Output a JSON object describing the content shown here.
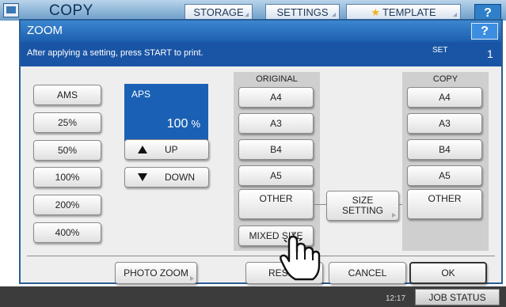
{
  "app": {
    "title": "COPY",
    "tabs": [
      "STORAGE",
      "SETTINGS",
      "TEMPLATE"
    ],
    "help": "?"
  },
  "dialog": {
    "title": "ZOOM",
    "help": "?",
    "message": "After applying a setting, press START to print.",
    "set_label": "SET",
    "set_count": "1"
  },
  "zoom_presets": [
    "AMS",
    "25%",
    "50%",
    "100%",
    "200%",
    "400%"
  ],
  "aps": {
    "label": "APS",
    "value": "100",
    "unit": "%"
  },
  "adjust": {
    "up": "UP",
    "down": "DOWN"
  },
  "original": {
    "title": "ORIGINAL",
    "sizes": [
      "A4",
      "A3",
      "B4",
      "A5",
      "OTHER",
      "MIXED SIZE"
    ]
  },
  "size_setting": "SIZE\nSETTING",
  "copy": {
    "title": "COPY",
    "sizes": [
      "A4",
      "A3",
      "B4",
      "A5",
      "OTHER"
    ]
  },
  "footer": {
    "photo_zoom": "PHOTO ZOOM",
    "reset": "RESET",
    "cancel": "CANCEL",
    "ok": "OK"
  },
  "status": {
    "time": "12:17",
    "job_status": "JOB STATUS"
  },
  "colors": {
    "accent_blue": "#1a61b5",
    "title_bar": "#2a70c0",
    "panel_gray": "#cfcfcf",
    "template_star": "#f0b21a"
  }
}
